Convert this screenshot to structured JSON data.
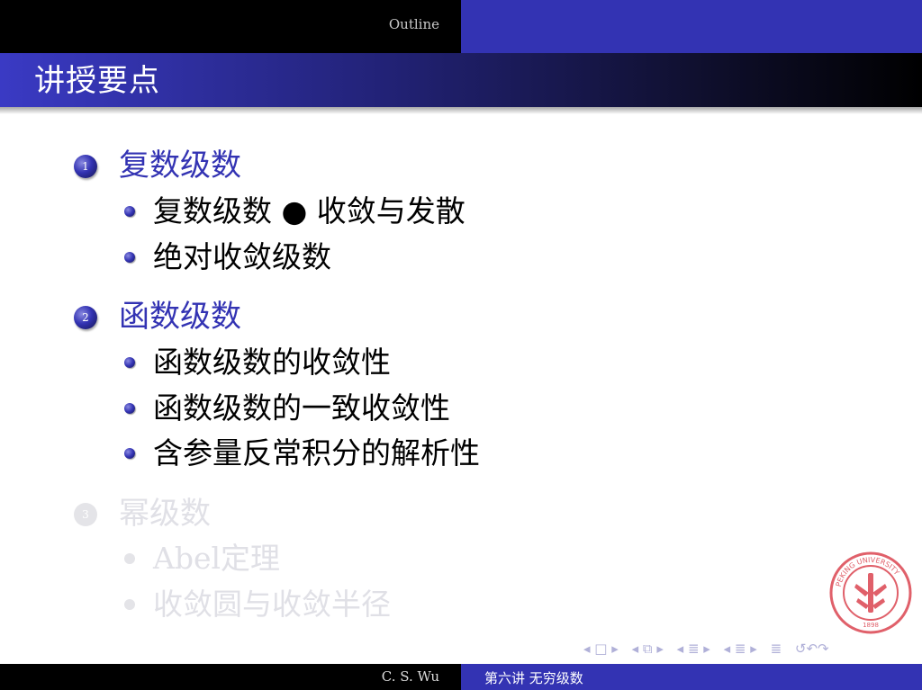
{
  "header": {
    "outline_label": "Outline"
  },
  "frame": {
    "title": "讲授要点"
  },
  "sections": [
    {
      "number": "1",
      "title": "复数级数",
      "items": [
        "复数级数 ● 收敛与发散",
        "绝对收敛级数"
      ],
      "faded": false
    },
    {
      "number": "2",
      "title": "函数级数",
      "items": [
        "函数级数的收敛性",
        "函数级数的一致收敛性",
        "含参量反常积分的解析性"
      ],
      "faded": false
    },
    {
      "number": "3",
      "title": "幂级数",
      "items": [
        "Abel定理",
        "收敛圆与收敛半径"
      ],
      "faded": true
    }
  ],
  "navigation": {
    "frame_nav": "◂ □ ▸",
    "subsection_nav": "◂ ⧉ ▸",
    "section_nav": "◂ ≣ ▸",
    "subsec_nav2": "◂ ≣ ▸",
    "align": "≣",
    "search_back": "↺↶↷"
  },
  "seal": {
    "text": "PEKING UNIVERSITY",
    "year": "1898"
  },
  "footer": {
    "author": "C. S. Wu",
    "lecture": "第六讲  无穷级数"
  },
  "colors": {
    "accent": "#3333b3",
    "header_dark": "#000000",
    "faded": "#e0e0e6",
    "seal": "#e0606a"
  }
}
